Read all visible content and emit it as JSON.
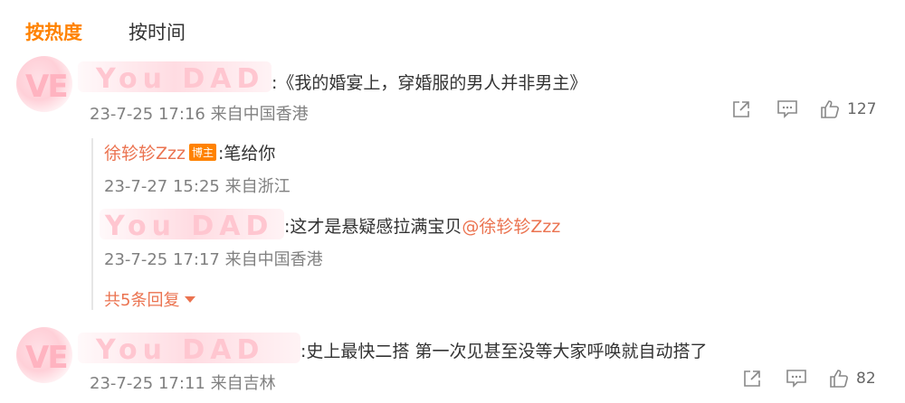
{
  "tabs": {
    "active": "按热度",
    "inactive": "按时间"
  },
  "comments": [
    {
      "text": ":《我的婚宴上，穿婚服的男人并非男主》",
      "meta": "23-7-25 17:16 来自中国香港",
      "likes": "127",
      "avatar_text": "VE",
      "name_text": "You DAD"
    },
    {
      "text": ":史上最快二搭 第一次见甚至没等大家呼唤就自动搭了",
      "meta": "23-7-25 17:11 来自吉林",
      "likes": "82",
      "avatar_text": "VE",
      "name_text": "You DAD"
    }
  ],
  "replies": [
    {
      "author": "徐轸轸Zzz",
      "badge": "博主",
      "text": ":笔给你",
      "meta": "23-7-27 15:25 来自浙江"
    },
    {
      "name_text": "You DAD",
      "text": ":这才是悬疑感拉满宝贝",
      "mention": "@徐轸轸Zzz",
      "meta": "23-7-25 17:17 来自中国香港"
    }
  ],
  "more_replies": "共5条回复",
  "icons": {
    "share": "share-icon",
    "comment": "comment-icon",
    "like": "like-icon",
    "expand": "caret-down-icon"
  },
  "colors": {
    "accent": "#ff8200",
    "link": "#eb7350",
    "meta": "#808080"
  }
}
